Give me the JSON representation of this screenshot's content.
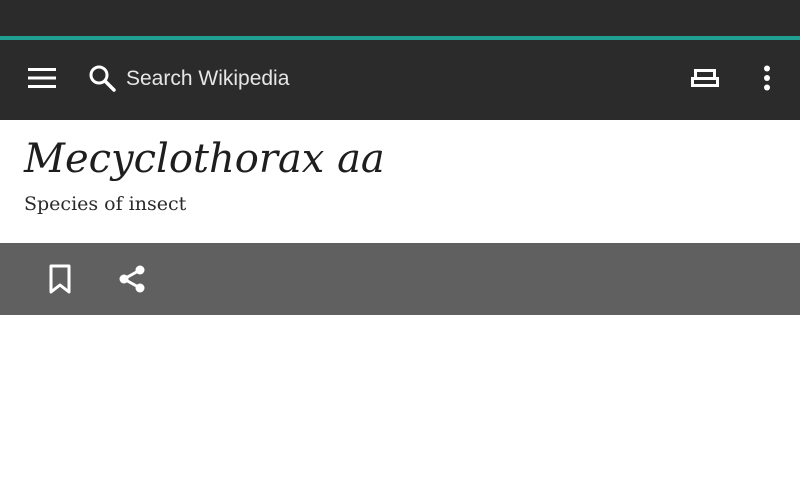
{
  "toolbar": {
    "search_placeholder": "Search Wikipedia",
    "menu_icon": "hamburger-menu-icon",
    "search_icon": "search-icon",
    "reading_list_icon": "reading-list-icon",
    "overflow_icon": "more-vertical-icon"
  },
  "article": {
    "title": "Mecyclothorax aa",
    "description": "Species of insect"
  },
  "actions": {
    "bookmark_icon": "bookmark-icon",
    "share_icon": "share-icon"
  },
  "colors": {
    "status_bar": "#2b2b2b",
    "accent": "#1f9e92",
    "toolbar": "#2b2b2b",
    "action_bar": "#606060"
  }
}
